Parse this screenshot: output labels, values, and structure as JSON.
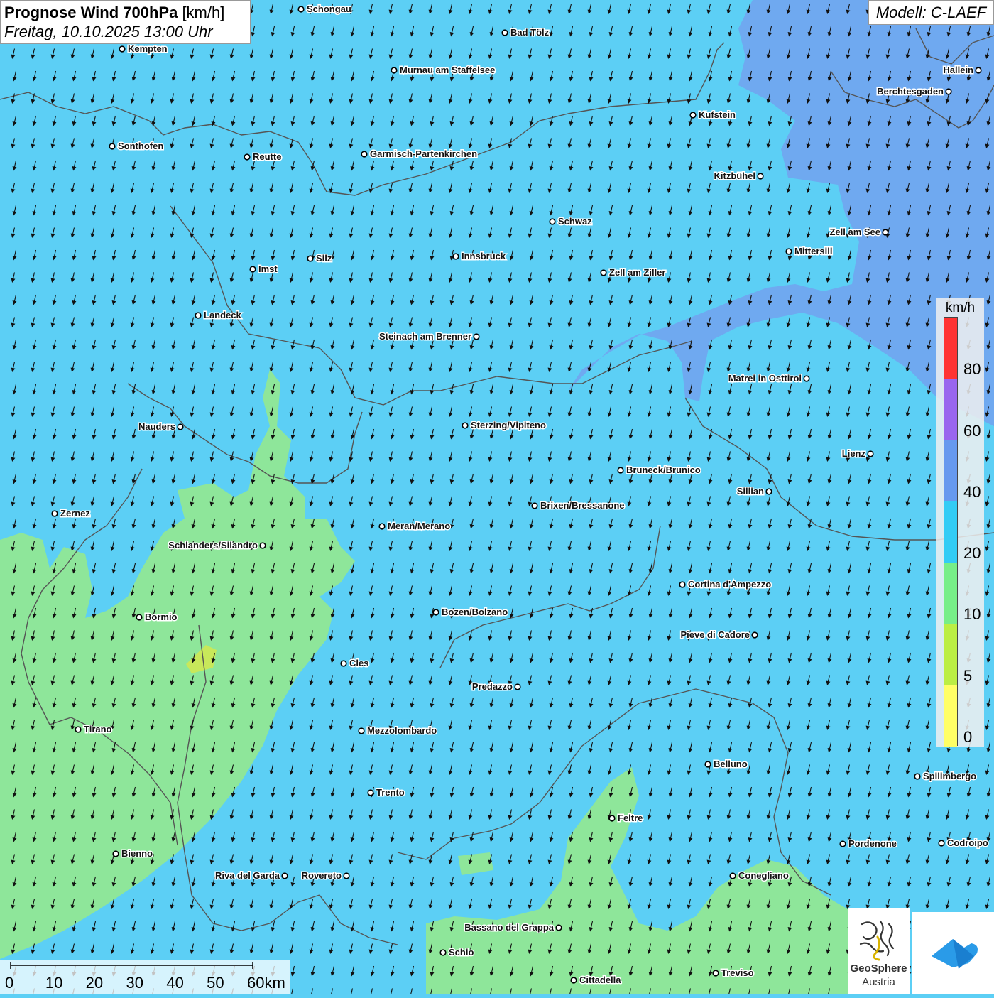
{
  "title": {
    "main": "Prognose Wind 700hPa",
    "unit": "[km/h]",
    "datetime": "Freitag, 10.10.2025 13:00 Uhr"
  },
  "model": "Modell: C-LAEF",
  "legend": {
    "unit": "km/h",
    "ticks": [
      "80",
      "60",
      "40",
      "20",
      "10",
      "5",
      "0"
    ],
    "colors": [
      "#ff3333",
      "#9966ee",
      "#6699ee",
      "#33ccf5",
      "#77ee88",
      "#bbee44",
      "#ffff66"
    ]
  },
  "colors": {
    "wind_10_20": "#5ccff5",
    "wind_20_40": "#6fa9f0",
    "wind_5_10": "#8ee69a",
    "wind_0_5": "#c8e85a",
    "borders": "#555555",
    "arrows": "#111111"
  },
  "scale": {
    "ticks": [
      "0",
      "10",
      "20",
      "30",
      "40",
      "50",
      "60km"
    ]
  },
  "wind": {
    "direction": "from north-northeast (arrows pointing south-southwest)"
  },
  "cities": [
    {
      "name": "Schongau",
      "lon": 424,
      "lat": 13,
      "side": "right"
    },
    {
      "name": "Bad Tölz",
      "lon": 711,
      "lat": 46,
      "side": "right"
    },
    {
      "name": "Kempten",
      "lon": 172,
      "lat": 69,
      "side": "right"
    },
    {
      "name": "Murnau am Staffelsee",
      "lon": 555,
      "lat": 99,
      "side": "right"
    },
    {
      "name": "Hallein",
      "lon": 1378,
      "lat": 99,
      "side": "left"
    },
    {
      "name": "Berchtesgaden",
      "lon": 1336,
      "lat": 129,
      "side": "left"
    },
    {
      "name": "Kufstein",
      "lon": 976,
      "lat": 162,
      "side": "right"
    },
    {
      "name": "Sonthofen",
      "lon": 158,
      "lat": 206,
      "side": "right"
    },
    {
      "name": "Reutte",
      "lon": 348,
      "lat": 221,
      "side": "right"
    },
    {
      "name": "Garmisch-Partenkirchen",
      "lon": 513,
      "lat": 217,
      "side": "right"
    },
    {
      "name": "Kitzbühel",
      "lon": 1071,
      "lat": 248,
      "side": "left"
    },
    {
      "name": "Schwaz",
      "lon": 778,
      "lat": 312,
      "side": "right"
    },
    {
      "name": "Zell am See",
      "lon": 1247,
      "lat": 327,
      "side": "left"
    },
    {
      "name": "Mittersill",
      "lon": 1111,
      "lat": 354,
      "side": "right"
    },
    {
      "name": "Innsbruck",
      "lon": 642,
      "lat": 361,
      "side": "right"
    },
    {
      "name": "Silz",
      "lon": 437,
      "lat": 364,
      "side": "right"
    },
    {
      "name": "Imst",
      "lon": 356,
      "lat": 379,
      "side": "right"
    },
    {
      "name": "Zell am Ziller",
      "lon": 850,
      "lat": 384,
      "side": "right"
    },
    {
      "name": "Landeck",
      "lon": 279,
      "lat": 444,
      "side": "right"
    },
    {
      "name": "Steinach am Brenner",
      "lon": 671,
      "lat": 474,
      "side": "left"
    },
    {
      "name": "Matrei in Osttirol",
      "lon": 1136,
      "lat": 533,
      "side": "left"
    },
    {
      "name": "Nauders",
      "lon": 254,
      "lat": 601,
      "side": "left"
    },
    {
      "name": "Sterzing/Vipiteno",
      "lon": 655,
      "lat": 599,
      "side": "right"
    },
    {
      "name": "Lienz",
      "lon": 1226,
      "lat": 639,
      "side": "left"
    },
    {
      "name": "Bruneck/Brunico",
      "lon": 874,
      "lat": 662,
      "side": "right"
    },
    {
      "name": "Sillian",
      "lon": 1083,
      "lat": 692,
      "side": "left"
    },
    {
      "name": "Brixen/Bressanone",
      "lon": 753,
      "lat": 712,
      "side": "right"
    },
    {
      "name": "Zernez",
      "lon": 77,
      "lat": 723,
      "side": "right"
    },
    {
      "name": "Meran/Merano",
      "lon": 538,
      "lat": 741,
      "side": "right"
    },
    {
      "name": "Schlanders/Silandro",
      "lon": 370,
      "lat": 768,
      "side": "left"
    },
    {
      "name": "Cortina d'Ampezzo",
      "lon": 961,
      "lat": 823,
      "side": "right"
    },
    {
      "name": "Bozen/Bolzano",
      "lon": 614,
      "lat": 862,
      "side": "right"
    },
    {
      "name": "Bormio",
      "lon": 196,
      "lat": 869,
      "side": "right"
    },
    {
      "name": "Pieve di Cadore",
      "lon": 1063,
      "lat": 894,
      "side": "left"
    },
    {
      "name": "Cles",
      "lon": 484,
      "lat": 934,
      "side": "right"
    },
    {
      "name": "Predazzo",
      "lon": 729,
      "lat": 967,
      "side": "left"
    },
    {
      "name": "Tirano",
      "lon": 110,
      "lat": 1027,
      "side": "right"
    },
    {
      "name": "Mezzolombardo",
      "lon": 509,
      "lat": 1029,
      "side": "right"
    },
    {
      "name": "Belluno",
      "lon": 997,
      "lat": 1076,
      "side": "right"
    },
    {
      "name": "Spilimbergo",
      "lon": 1292,
      "lat": 1093,
      "side": "right"
    },
    {
      "name": "Trento",
      "lon": 522,
      "lat": 1116,
      "side": "right"
    },
    {
      "name": "Feltre",
      "lon": 862,
      "lat": 1152,
      "side": "right"
    },
    {
      "name": "Pordenone",
      "lon": 1187,
      "lat": 1188,
      "side": "right"
    },
    {
      "name": "Codroipo",
      "lon": 1326,
      "lat": 1187,
      "side": "right"
    },
    {
      "name": "Bienno",
      "lon": 163,
      "lat": 1202,
      "side": "right"
    },
    {
      "name": "Riva del Garda",
      "lon": 401,
      "lat": 1233,
      "side": "left"
    },
    {
      "name": "Rovereto",
      "lon": 488,
      "lat": 1233,
      "side": "left"
    },
    {
      "name": "Conegliano",
      "lon": 1032,
      "lat": 1233,
      "side": "right"
    },
    {
      "name": "Bassano del Grappa",
      "lon": 787,
      "lat": 1306,
      "side": "left"
    },
    {
      "name": "Schio",
      "lon": 624,
      "lat": 1341,
      "side": "right"
    },
    {
      "name": "Treviso",
      "lon": 1008,
      "lat": 1370,
      "side": "right"
    },
    {
      "name": "Cittadella",
      "lon": 808,
      "lat": 1380,
      "side": "right"
    }
  ],
  "logos": {
    "geosphere_name": "GeoSphere",
    "geosphere_sub": "Austria"
  }
}
